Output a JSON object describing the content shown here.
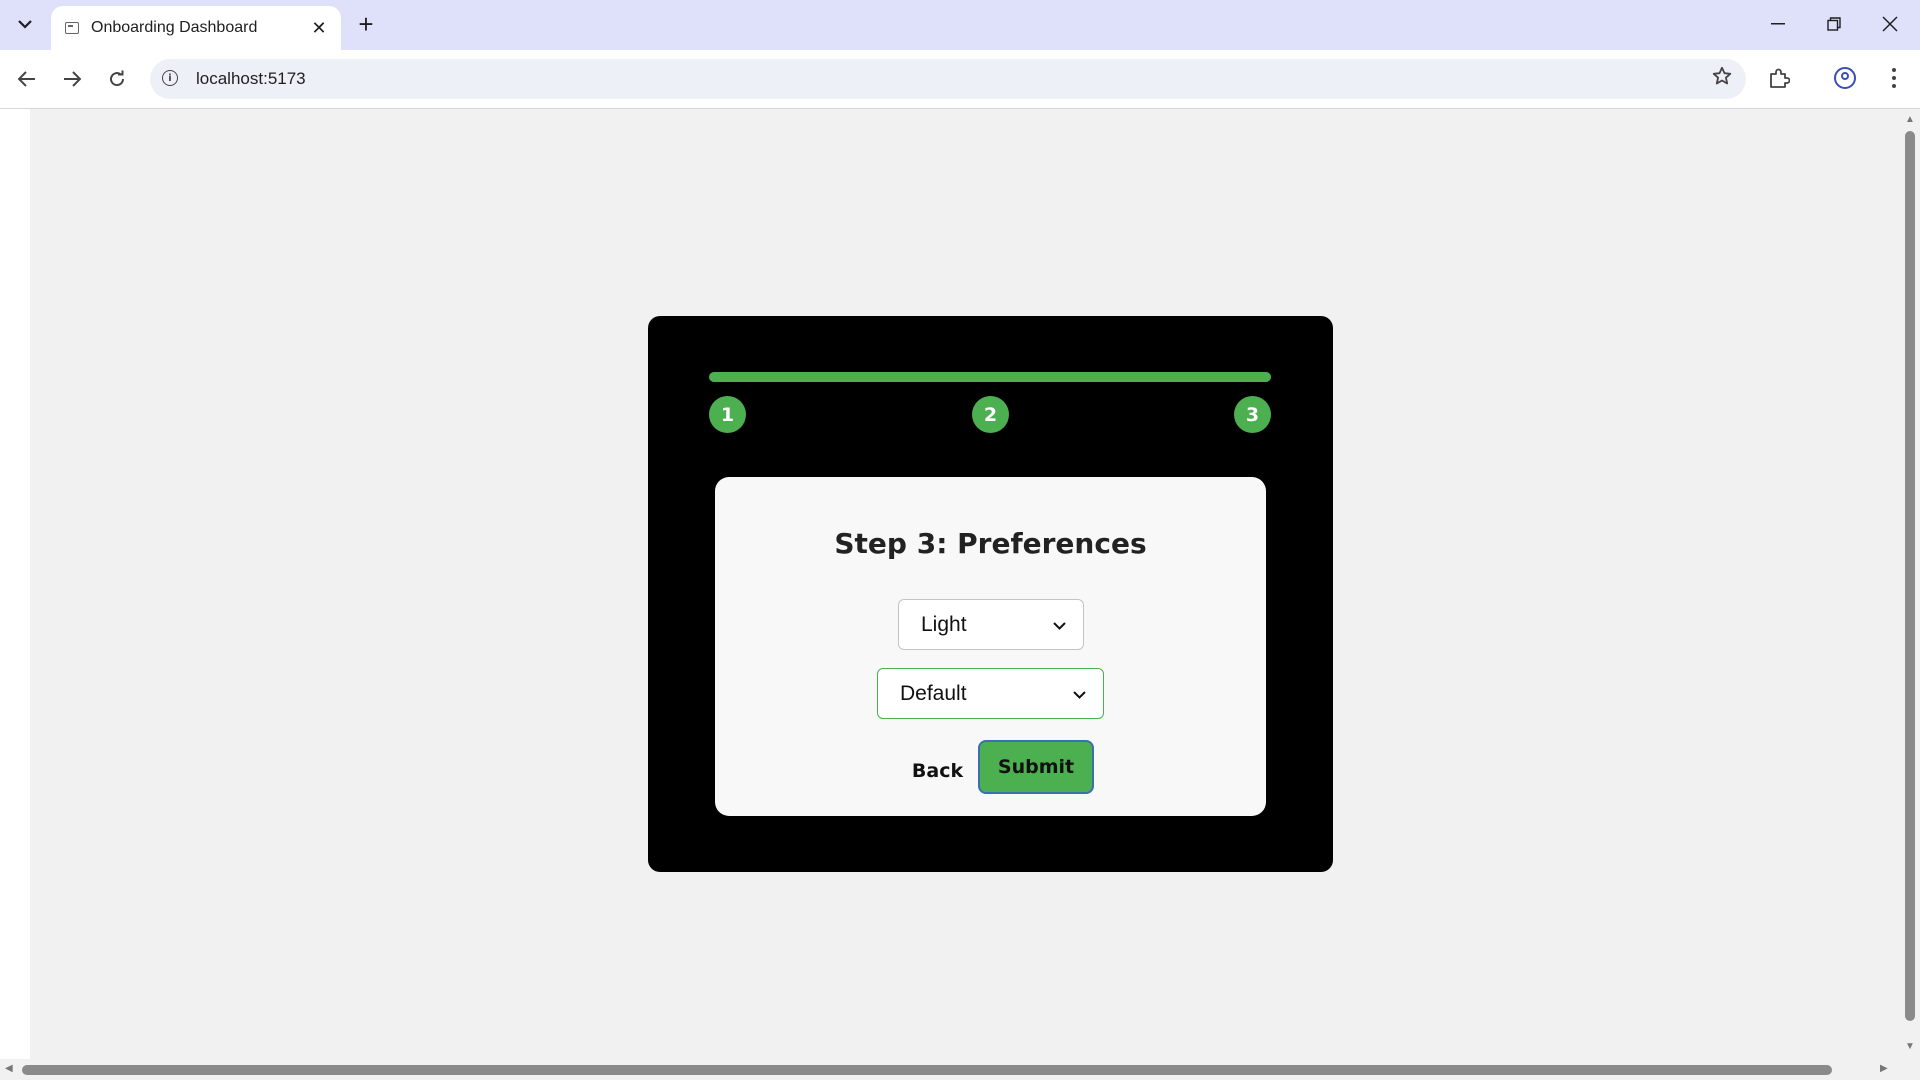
{
  "browser": {
    "tab_title": "Onboarding Dashboard",
    "url": "localhost:5173",
    "new_tab_symbol": "+",
    "close_symbol": "✕"
  },
  "wizard": {
    "progress": 1.0,
    "accent_color": "#4caf50",
    "steps": [
      "1",
      "2",
      "3"
    ],
    "title": "Step 3: Preferences",
    "theme_select": {
      "value": "Light"
    },
    "layout_select": {
      "value": "Default"
    },
    "back_label": "Back",
    "submit_label": "Submit"
  }
}
